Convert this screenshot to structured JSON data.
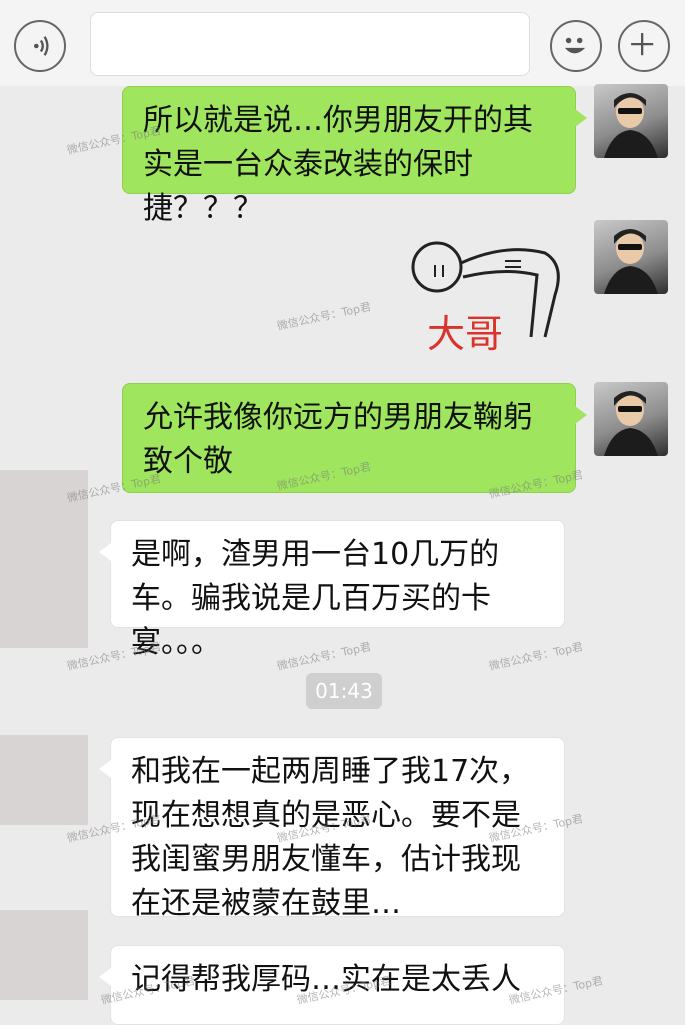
{
  "messages": {
    "m1": "所以就是说…你男朋友开的其实是一台众泰改装的保时捷？？？",
    "m2_sticker_text": "大哥",
    "m3": "允许我像你远方的男朋友鞠躬致个敬",
    "m4": "是啊，渣男用一台10几万的车。骗我说是几百万买的卡宴。。。",
    "time": "01:43",
    "m5": "和我在一起两周睡了我17次，现在想想真的是恶心。要不是我闺蜜男朋友懂车，估计我现在还是被蒙在鼓里…",
    "m6": "记得帮我厚码…实在是太丢人"
  },
  "watermark": "微信公众号：Top君",
  "icons": {
    "voice": "voice-icon",
    "emoji": "smiley-icon",
    "more": "plus-icon"
  },
  "colors": {
    "outgoing_bubble": "#9fe55d",
    "incoming_bubble": "#ffffff",
    "background": "#ebebeb"
  }
}
